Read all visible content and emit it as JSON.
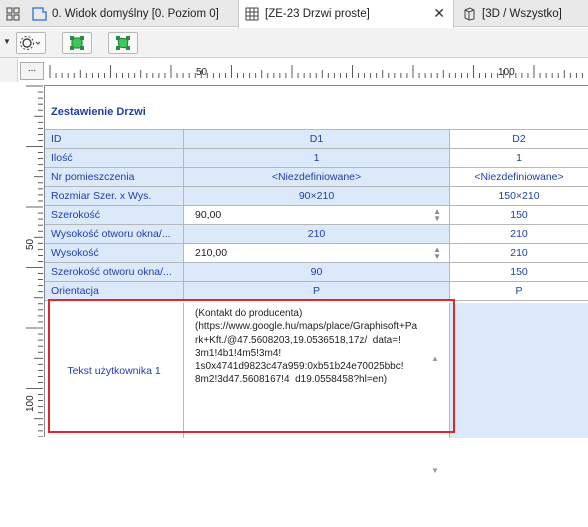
{
  "tabs": [
    {
      "label": "0. Widok domyślny [0. Poziom 0]"
    },
    {
      "label": "[ZE-23 Drzwi proste]",
      "active": true
    },
    {
      "label": "[3D / Wszystko]"
    }
  ],
  "ruler": {
    "corner": "...",
    "h_labels": [
      "50",
      "100"
    ],
    "v_labels": [
      "50",
      "100"
    ]
  },
  "schedule": {
    "title": "Zestawienie Drzwi",
    "rows": [
      {
        "label": "ID",
        "d1": "D1",
        "d2": "D2"
      },
      {
        "label": "Ilość",
        "d1": "1",
        "d2": "1"
      },
      {
        "label": "Nr pomieszczenia",
        "d1": "<Niezdefiniowane>",
        "d2": "<Niezdefiniowane>"
      },
      {
        "label": "Rozmiar Szer. x Wys.",
        "d1": "90×210",
        "d2": "150×210"
      },
      {
        "label": "Szerokość",
        "d1": "90,00",
        "d2": "150"
      },
      {
        "label": "Wysokość otworu okna/...",
        "d1": "210",
        "d2": "210"
      },
      {
        "label": "Wysokość",
        "d1": "210,00",
        "d2": "210"
      },
      {
        "label": "Szerokość otworu okna/...",
        "d1": "90",
        "d2": "150"
      },
      {
        "label": "Orientacja",
        "d1": "P",
        "d2": "P"
      }
    ],
    "text_row": {
      "label": "Tekst użytkownika  1",
      "d1": "(Kontakt do producenta)\n(https://www.google.hu/maps/place/Graphisoft+Pa\nrk+Kft./@47.5608203,19.0536518,17z/  data=!\n3m1!4b1!4m5!3m4!\n1s0x4741d9823c47a959:0xb51b24e70025bbc!\n8m2!3d47.5608167!4  d19.0558458?hl=en)"
    }
  },
  "colors": {
    "accent_text": "#1f3ea8",
    "cell_bg": "#dbe9fb",
    "highlight": "#e0262a"
  }
}
